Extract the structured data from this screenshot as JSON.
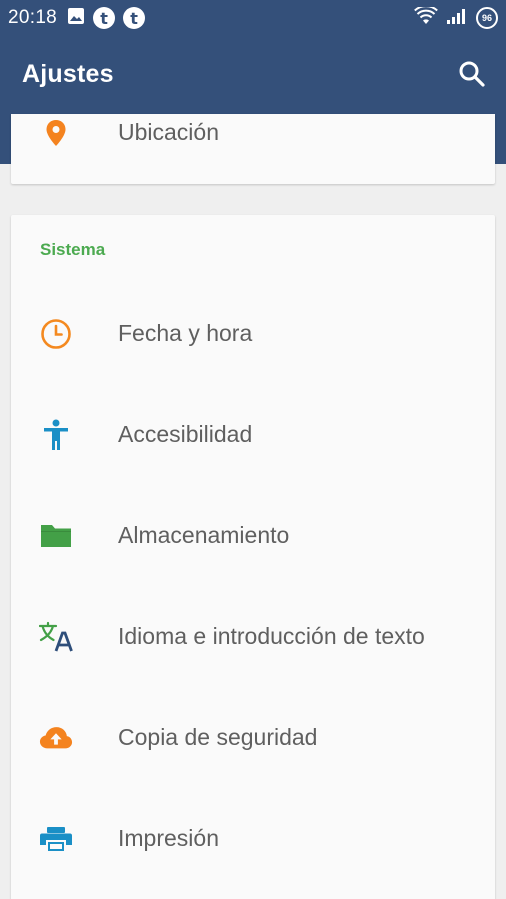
{
  "status_bar": {
    "time": "20:18",
    "tumblr_glyph": "t",
    "battery_level": "96"
  },
  "app_bar": {
    "title": "Ajustes"
  },
  "top_card": {
    "item": {
      "label": "Ubicación",
      "icon": "location-pin-icon",
      "color": "#f4831f"
    }
  },
  "system_section": {
    "title": "Sistema",
    "title_color": "#4caa50",
    "items": [
      {
        "label": "Fecha y hora",
        "icon": "clock-icon",
        "color": "#f4891f"
      },
      {
        "label": "Accesibilidad",
        "icon": "accessibility-icon",
        "color": "#1a8fc6"
      },
      {
        "label": "Almacenamiento",
        "icon": "folder-icon",
        "color": "#43a047"
      },
      {
        "label": "Idioma e introducción de texto",
        "icon": "translate-icon",
        "color": "#2e4e7a"
      },
      {
        "label": "Copia de seguridad",
        "icon": "cloud-upload-icon",
        "color": "#f4831f"
      },
      {
        "label": "Impresión",
        "icon": "printer-icon",
        "color": "#1a8fc6"
      }
    ]
  },
  "colors": {
    "primary": "#34507a",
    "background": "#efefef",
    "card": "#fafafa",
    "text": "#5f5f5f"
  }
}
